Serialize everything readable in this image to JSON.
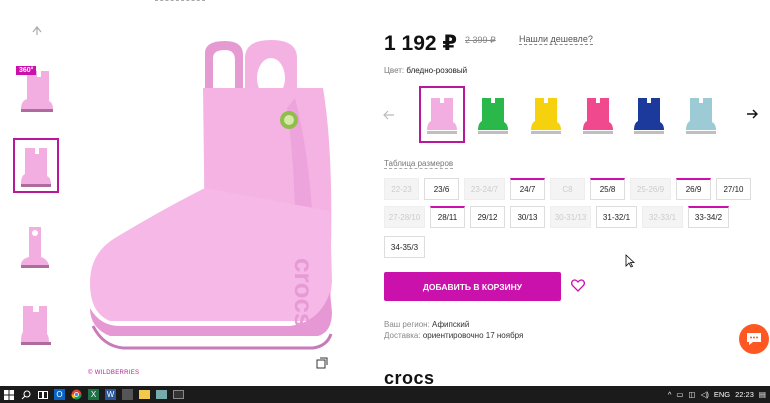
{
  "product": {
    "price": "1 192 ₽",
    "old_price": "2 399 ₽",
    "cheaper_link": "Нашли дешевле?",
    "color_label": "Цвет:",
    "color_value": "бледно-розовый",
    "badge_360": "360°",
    "watermark": "© WILDBERRIES"
  },
  "swatch_colors": [
    "#f2aee0",
    "#2bb84a",
    "#f5d20d",
    "#f0498e",
    "#1b3a9c",
    "#9ccbd6"
  ],
  "sizes": {
    "title": "Таблица размеров",
    "rows": [
      [
        {
          "label": "22-23",
          "available": false
        },
        {
          "label": "23/6",
          "available": true,
          "marked": false
        },
        {
          "label": "23-24/7",
          "available": false
        },
        {
          "label": "24/7",
          "available": true,
          "marked": true
        },
        {
          "label": "C8",
          "available": false
        },
        {
          "label": "25/8",
          "available": true,
          "marked": true
        },
        {
          "label": "25-26/9",
          "available": false
        },
        {
          "label": "26/9",
          "available": true,
          "marked": true
        },
        {
          "label": "27/10",
          "available": true,
          "marked": false
        }
      ],
      [
        {
          "label": "27-28/10",
          "available": false
        },
        {
          "label": "28/11",
          "available": true,
          "marked": true
        },
        {
          "label": "29/12",
          "available": true,
          "marked": false
        },
        {
          "label": "30/13",
          "available": true,
          "marked": false
        },
        {
          "label": "30-31/13",
          "available": false
        },
        {
          "label": "31-32/1",
          "available": true,
          "marked": false
        },
        {
          "label": "32-33/1",
          "available": false
        },
        {
          "label": "33-34/2",
          "available": true,
          "marked": true
        }
      ],
      [
        {
          "label": "34-35/3",
          "available": true,
          "marked": false
        }
      ]
    ]
  },
  "cart_button": "ДОБАВИТЬ В КОРЗИНУ",
  "region": {
    "label": "Ваш регион:",
    "value": "Афипский"
  },
  "delivery": {
    "label": "Доставка:",
    "value": "ориентировочно 17 ноября"
  },
  "brand": "crocs",
  "taskbar": {
    "language": "ENG",
    "time": "22:23",
    "icons": [
      "windows-start-icon",
      "search-icon",
      "task-view-icon",
      "outlook-icon",
      "chrome-icon",
      "excel-icon",
      "word-icon",
      "store-icon",
      "file-explorer-icon",
      "photos-icon",
      "terminal-icon"
    ]
  }
}
